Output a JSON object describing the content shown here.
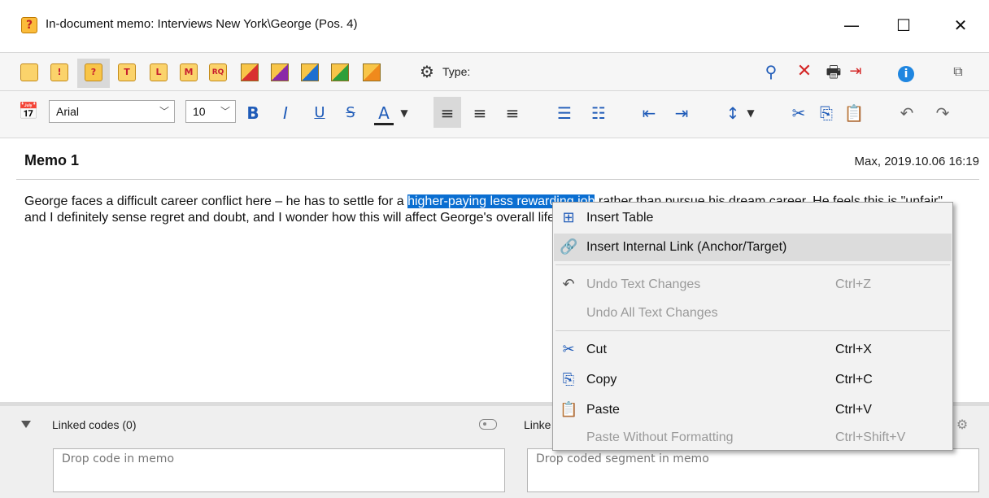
{
  "window": {
    "title": "In-document memo: Interviews New York\\George (Pos. 4)",
    "app_icon_glyph": "?",
    "minimize_glyph": "—",
    "maximize_glyph": "☐",
    "close_glyph": "✕"
  },
  "toolbar": {
    "memo_types": [
      "",
      "!",
      "?",
      "T",
      "L",
      "M",
      "RQ"
    ],
    "type_label": "Type:",
    "right_icons": [
      "search-icon",
      "delete-icon",
      "print-icon",
      "export-icon",
      "info-icon",
      "undock-icon"
    ]
  },
  "format": {
    "font": "Arial",
    "size": "10",
    "bold": "B",
    "italic": "I",
    "underline": "U",
    "strike": "S",
    "color": "A"
  },
  "memo": {
    "title": "Memo 1",
    "meta": "Max, 2019.10.06 16:19",
    "text_before": "George faces a difficult career conflict here – he has to settle for a ",
    "text_highlight": "higher-paying less rewarding job",
    "text_after": " rather than pursue his dream career. He feels this is \"unfair\" and I definitely sense regret and doubt, and I wonder how this will affect George's overall life satisfaction in his future."
  },
  "panels": {
    "linked_codes": "Linked codes (0)",
    "linked_codes_placeholder": "Drop code in memo",
    "linked_segments": "Linke",
    "linked_segments_placeholder": "Drop coded segment in memo"
  },
  "context_menu": {
    "insert_table": "Insert Table",
    "insert_link": "Insert Internal Link (Anchor/Target)",
    "undo": "Undo Text Changes",
    "undo_shortcut": "Ctrl+Z",
    "undo_all": "Undo All Text Changes",
    "cut": "Cut",
    "cut_shortcut": "Ctrl+X",
    "copy": "Copy",
    "copy_shortcut": "Ctrl+C",
    "paste": "Paste",
    "paste_shortcut": "Ctrl+V",
    "paste_plain": "Paste Without Formatting",
    "paste_plain_shortcut": "Ctrl+Shift+V"
  },
  "colors": {
    "selection": "#0a6ed1",
    "memo_yellow": "#fbd36b",
    "memo_red": "#c8202f",
    "menu_bg": "#f2f2f2"
  }
}
